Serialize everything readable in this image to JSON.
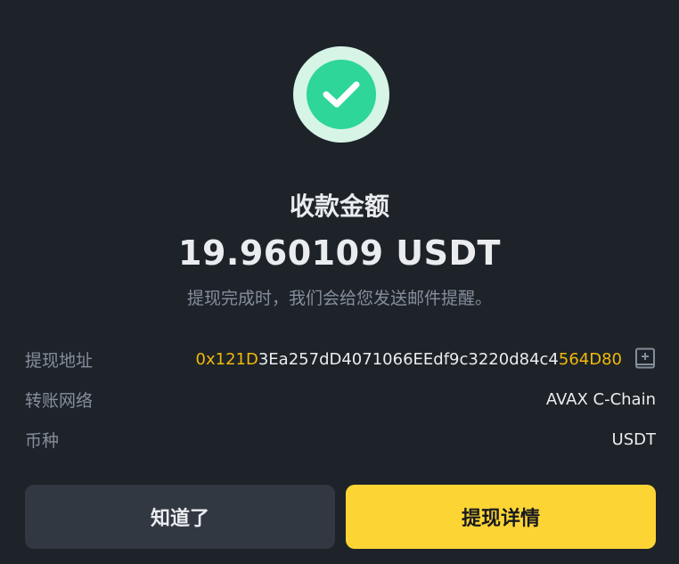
{
  "success": {
    "icon": "check-circle-icon"
  },
  "title": "收款金额",
  "amount": "19.960109 USDT",
  "note": "提现完成时，我们会给您发送邮件提醒。",
  "details": {
    "address_label": "提现地址",
    "address_prefix": "0x121D",
    "address_middle": "3Ea257dD4071066EEdf9c3220d84c4",
    "address_suffix": "564D80",
    "network_label": "转账网络",
    "network_value": "AVAX C-Chain",
    "coin_label": "币种",
    "coin_value": "USDT"
  },
  "buttons": {
    "ok_label": "知道了",
    "detail_label": "提现详情"
  },
  "colors": {
    "background": "#1e2329",
    "accent": "#fcd535",
    "highlight": "#f0b90b",
    "success": "#2ed69a"
  }
}
